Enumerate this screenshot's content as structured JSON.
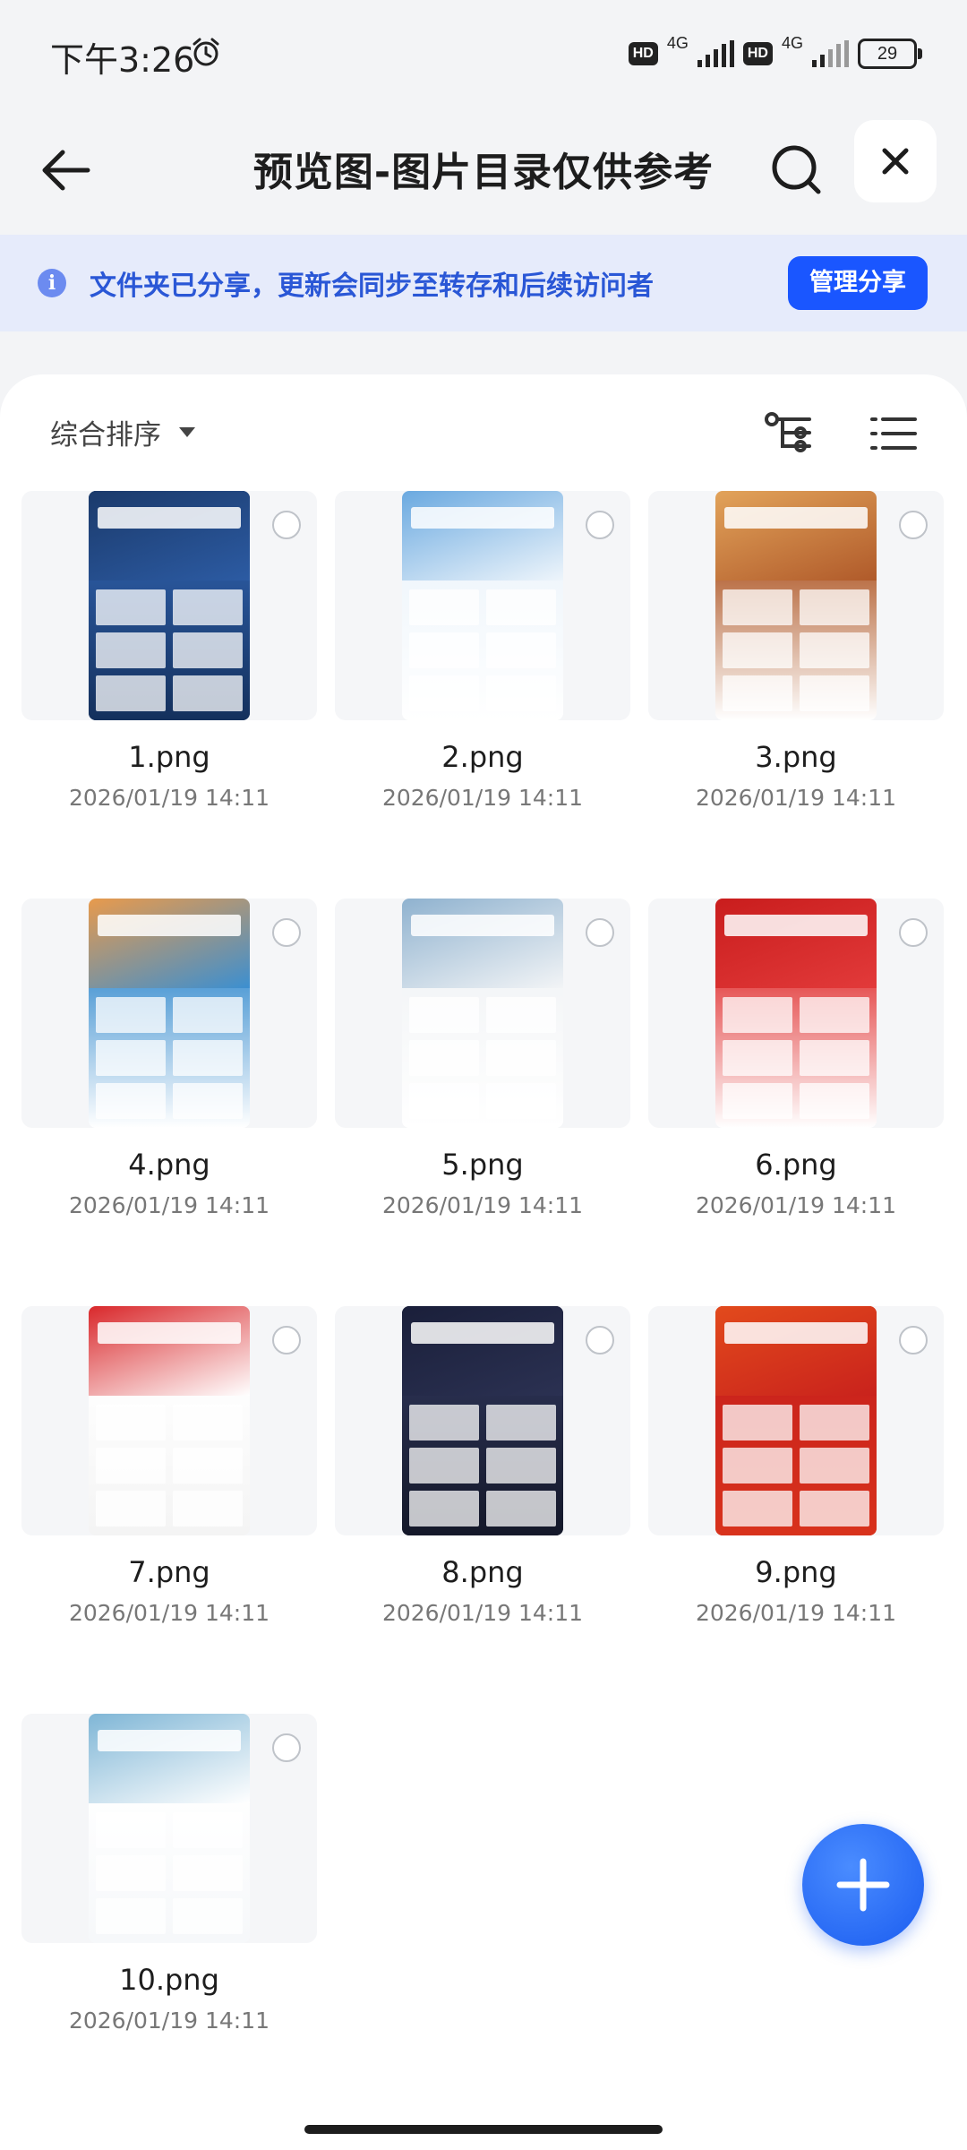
{
  "status_bar": {
    "time": "下午3:26",
    "hd_label": "HD",
    "net_label": "4G",
    "battery": "29"
  },
  "header": {
    "title": "预览图-图片目录仅供参考"
  },
  "share_banner": {
    "text": "文件夹已分享，更新会同步至转存和后续访问者",
    "manage_button": "管理分享"
  },
  "toolbar": {
    "sort_label": "综合排序"
  },
  "files": [
    {
      "name": "1.png",
      "date": "2026/01/19 14:11",
      "colors": [
        "#1b3a6b",
        "#2c5ba3",
        "#14305c"
      ]
    },
    {
      "name": "2.png",
      "date": "2026/01/19 14:11",
      "colors": [
        "#6aa9e0",
        "#eef5fb",
        "#ffffff"
      ]
    },
    {
      "name": "3.png",
      "date": "2026/01/19 14:11",
      "colors": [
        "#e2a35a",
        "#b05a2a",
        "#ffffff"
      ]
    },
    {
      "name": "4.png",
      "date": "2026/01/19 14:11",
      "colors": [
        "#e89a4c",
        "#3c8fd0",
        "#ffffff"
      ]
    },
    {
      "name": "5.png",
      "date": "2026/01/19 14:11",
      "colors": [
        "#8fb2cf",
        "#f2f4f6",
        "#ffffff"
      ]
    },
    {
      "name": "6.png",
      "date": "2026/01/19 14:11",
      "colors": [
        "#c91d1d",
        "#e23a3a",
        "#ffffff"
      ]
    },
    {
      "name": "7.png",
      "date": "2026/01/19 14:11",
      "colors": [
        "#d9282b",
        "#ffffff",
        "#f4f4f4"
      ]
    },
    {
      "name": "8.png",
      "date": "2026/01/19 14:11",
      "colors": [
        "#1a1f3a",
        "#2b3152",
        "#141829"
      ]
    },
    {
      "name": "9.png",
      "date": "2026/01/19 14:11",
      "colors": [
        "#e24a1c",
        "#c9221c",
        "#d8321c"
      ]
    },
    {
      "name": "10.png",
      "date": "2026/01/19 14:11",
      "colors": [
        "#7fb6d6",
        "#ffffff",
        "#f6f8fa"
      ]
    }
  ]
}
